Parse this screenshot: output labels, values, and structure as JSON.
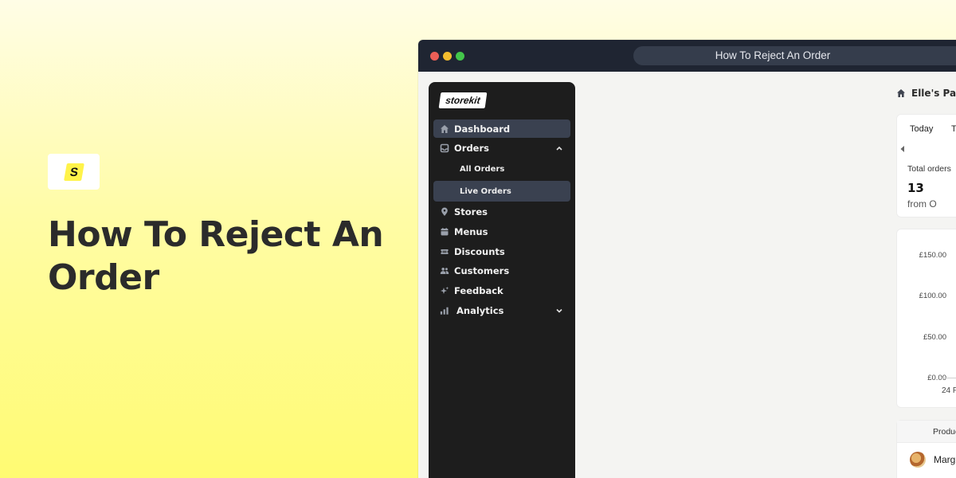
{
  "hero": {
    "logo_letter": "S",
    "title": "How To Reject An Order"
  },
  "window": {
    "address_title": "How To Reject An Order"
  },
  "sidebar": {
    "brand": "storekit",
    "items": [
      {
        "label": "Dashboard",
        "icon": "home-icon",
        "active": true
      },
      {
        "label": "Orders",
        "icon": "inbox-icon",
        "expanded": true
      },
      {
        "label": "Stores",
        "icon": "map-pin-icon"
      },
      {
        "label": "Menus",
        "icon": "calendar-icon"
      },
      {
        "label": "Discounts",
        "icon": "ticket-icon"
      },
      {
        "label": "Customers",
        "icon": "users-icon"
      },
      {
        "label": "Feedback",
        "icon": "sparkle-icon"
      },
      {
        "label": "Analytics",
        "icon": "bar-chart-icon",
        "expanded": false
      }
    ],
    "orders_sub": [
      {
        "label": "All Orders",
        "active": false
      },
      {
        "label": "Live Orders",
        "active": true
      }
    ]
  },
  "main": {
    "breadcrumb": "Elle's Pas",
    "stats": {
      "tab_today": "Today",
      "tab_next": "Th",
      "label": "Total orders",
      "value": "13",
      "sub": "from O"
    },
    "chart": {
      "yticks": [
        "£150.00",
        "£100.00",
        "£50.00",
        "£0.00"
      ],
      "xtick": "24 F"
    },
    "products": {
      "header": "Produc",
      "row_name": "Marg"
    }
  },
  "colors": {
    "sidebar_bg": "#1d1d1d",
    "active_item": "#3a4150",
    "titlebar": "#1f2532",
    "brand_yellow": "#fff34a"
  }
}
